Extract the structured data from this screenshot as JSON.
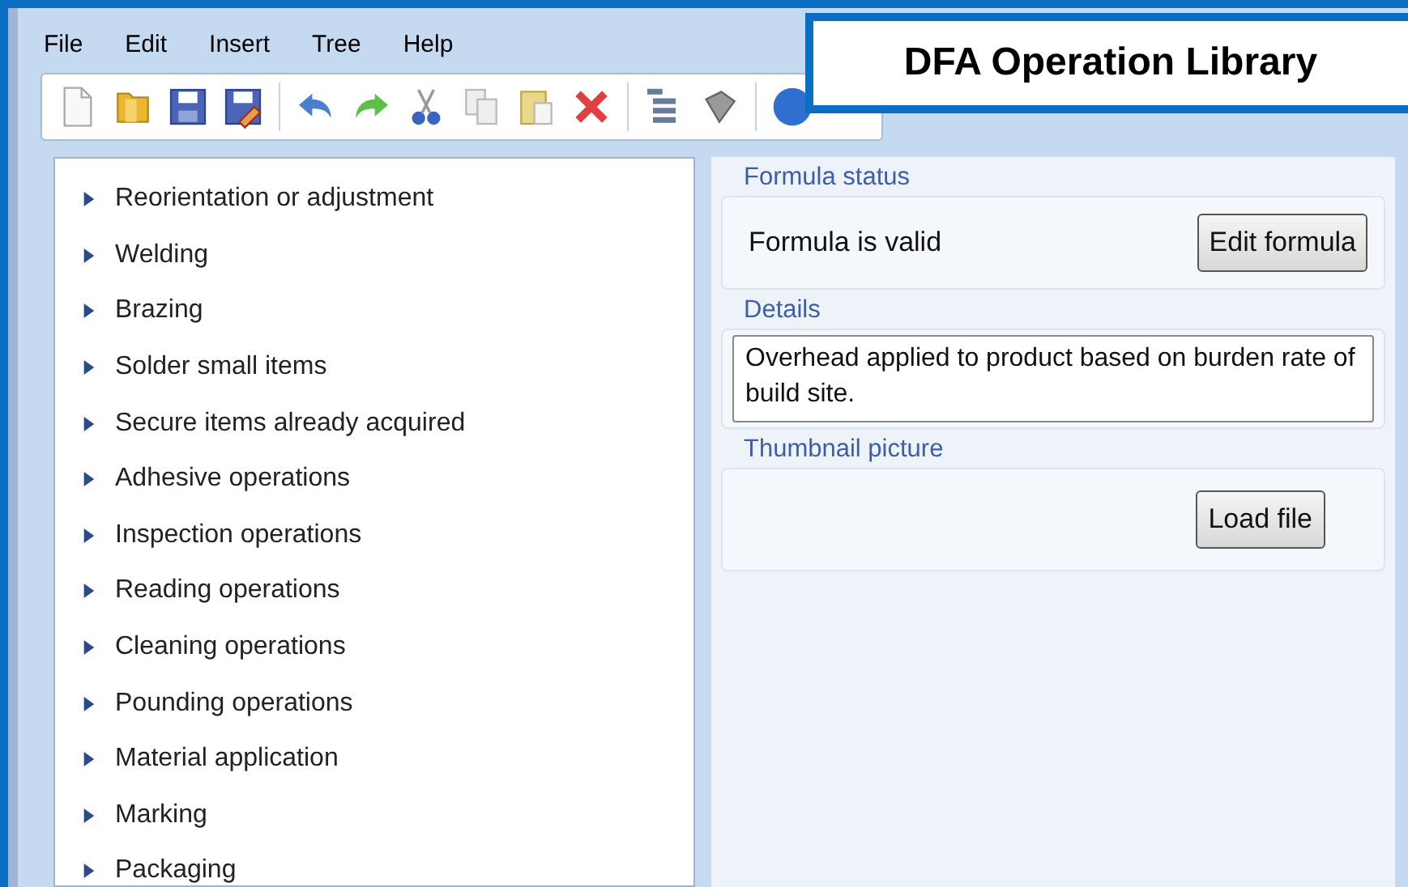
{
  "menu": [
    "File",
    "Edit",
    "Insert",
    "Tree",
    "Help"
  ],
  "toolbar": [
    {
      "kind": "new"
    },
    {
      "kind": "open"
    },
    {
      "kind": "save"
    },
    {
      "kind": "saveas"
    },
    {
      "kind": "sep"
    },
    {
      "kind": "undo"
    },
    {
      "kind": "redo"
    },
    {
      "kind": "cut"
    },
    {
      "kind": "copy"
    },
    {
      "kind": "paste"
    },
    {
      "kind": "delete"
    },
    {
      "kind": "sep"
    },
    {
      "kind": "tree"
    },
    {
      "kind": "export"
    },
    {
      "kind": "sep"
    },
    {
      "kind": "help"
    }
  ],
  "callout": {
    "title": "DFA Operation Library"
  },
  "tree": [
    {
      "label": "Reorientation or adjustment",
      "expanded": false
    },
    {
      "label": "Welding",
      "expanded": false
    },
    {
      "label": "Brazing",
      "expanded": false
    },
    {
      "label": "Solder small items",
      "expanded": false
    },
    {
      "label": "Secure items already acquired",
      "expanded": false
    },
    {
      "label": "Adhesive operations",
      "expanded": false
    },
    {
      "label": "Inspection operations",
      "expanded": false
    },
    {
      "label": "Reading operations",
      "expanded": false
    },
    {
      "label": "Cleaning operations",
      "expanded": false
    },
    {
      "label": "Pounding operations",
      "expanded": false
    },
    {
      "label": "Material application",
      "expanded": false
    },
    {
      "label": "Marking",
      "expanded": false
    },
    {
      "label": "Packaging",
      "expanded": false
    }
  ],
  "formula_status": {
    "title": "Formula status",
    "status": "Formula is valid",
    "button": "Edit formula"
  },
  "details": {
    "title": "Details",
    "value": "Overhead applied to product based on burden rate of build site."
  },
  "thumbnail": {
    "title": "Thumbnail picture",
    "button": "Load file"
  }
}
